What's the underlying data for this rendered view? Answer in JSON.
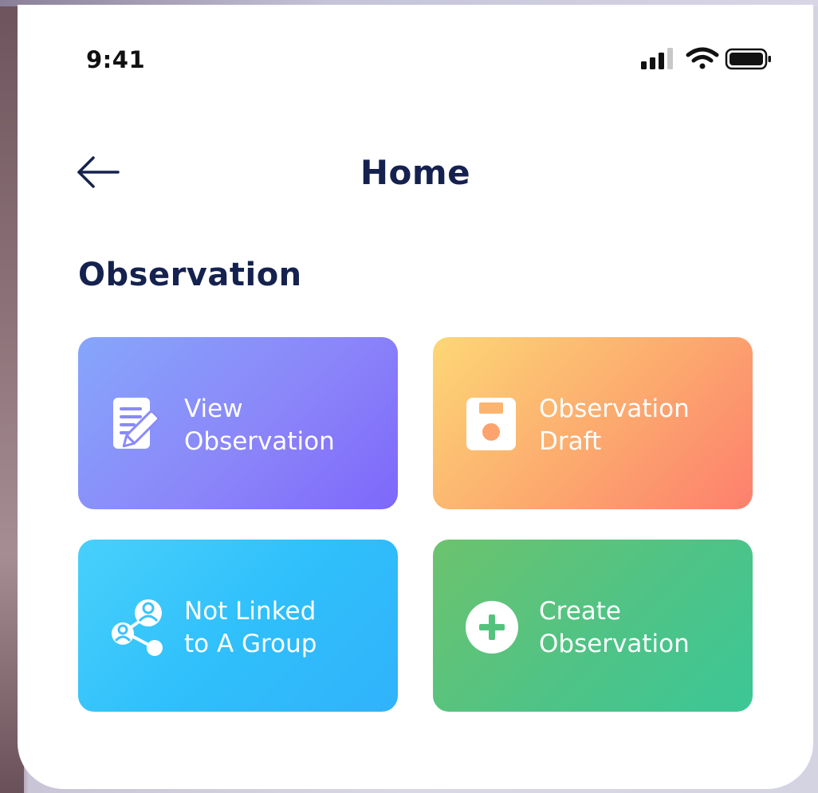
{
  "status_bar": {
    "time": "9:41",
    "icons": [
      "signal-icon",
      "wifi-icon",
      "battery-icon"
    ]
  },
  "header": {
    "title": "Home",
    "back_icon": "arrow-left-icon"
  },
  "section": {
    "title": "Observation"
  },
  "cards": [
    {
      "id": "view-observation",
      "line1": "View",
      "line2": "Observation",
      "icon": "document-edit-icon",
      "gradient": [
        "#86a6fb",
        "#7e67fa"
      ]
    },
    {
      "id": "observation-draft",
      "line1": "Observation",
      "line2": "Draft",
      "icon": "floppy-disk-icon",
      "gradient": [
        "#fdd776",
        "#fd7f6d"
      ]
    },
    {
      "id": "not-linked",
      "line1": "Not Linked",
      "line2": "to A Group",
      "icon": "group-share-icon",
      "gradient": [
        "#48d0fb",
        "#30b2fb"
      ]
    },
    {
      "id": "create-observation",
      "line1": "Create",
      "line2": "Observation",
      "icon": "plus-circle-icon",
      "gradient": [
        "#6cc36d",
        "#3cc796"
      ]
    }
  ],
  "colors": {
    "heading": "#15224f",
    "card_text": "#ffffff",
    "background": "#ffffff"
  }
}
